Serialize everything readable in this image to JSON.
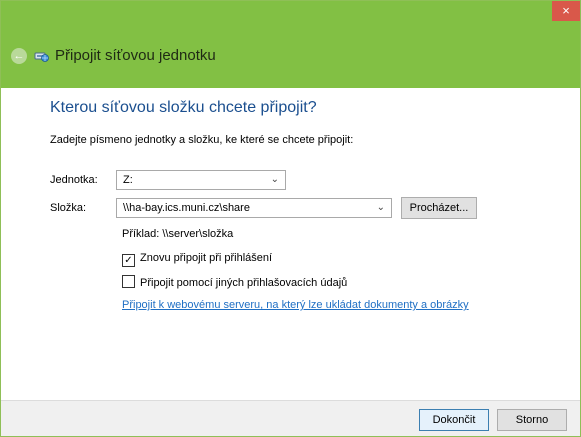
{
  "window": {
    "close_glyph": "×"
  },
  "header": {
    "title": "Připojit síťovou jednotku"
  },
  "main": {
    "heading": "Kterou síťovou složku chcete připojit?",
    "instruction": "Zadejte písmeno jednotky a složku, ke které se chcete připojit:",
    "drive": {
      "label": "Jednotka:",
      "value": "Z:"
    },
    "folder": {
      "label": "Složka:",
      "value": "\\\\ha-bay.ics.muni.cz\\share",
      "browse_label": "Procházet..."
    },
    "example": "Příklad: \\\\server\\složka",
    "reconnect": {
      "label": "Znovu připojit při přihlášení",
      "checked": true
    },
    "other_credentials": {
      "label": "Připojit pomocí jiných přihlašovacích údajů",
      "checked": false
    },
    "web_link": "Připojit k webovému serveru, na který lze ukládat dokumenty a obrázky"
  },
  "footer": {
    "finish_label": "Dokončit",
    "cancel_label": "Storno"
  },
  "colors": {
    "titlebar": "#82c044",
    "heading": "#1b4f8f",
    "link": "#1f6fc4",
    "close": "#d9584a"
  }
}
